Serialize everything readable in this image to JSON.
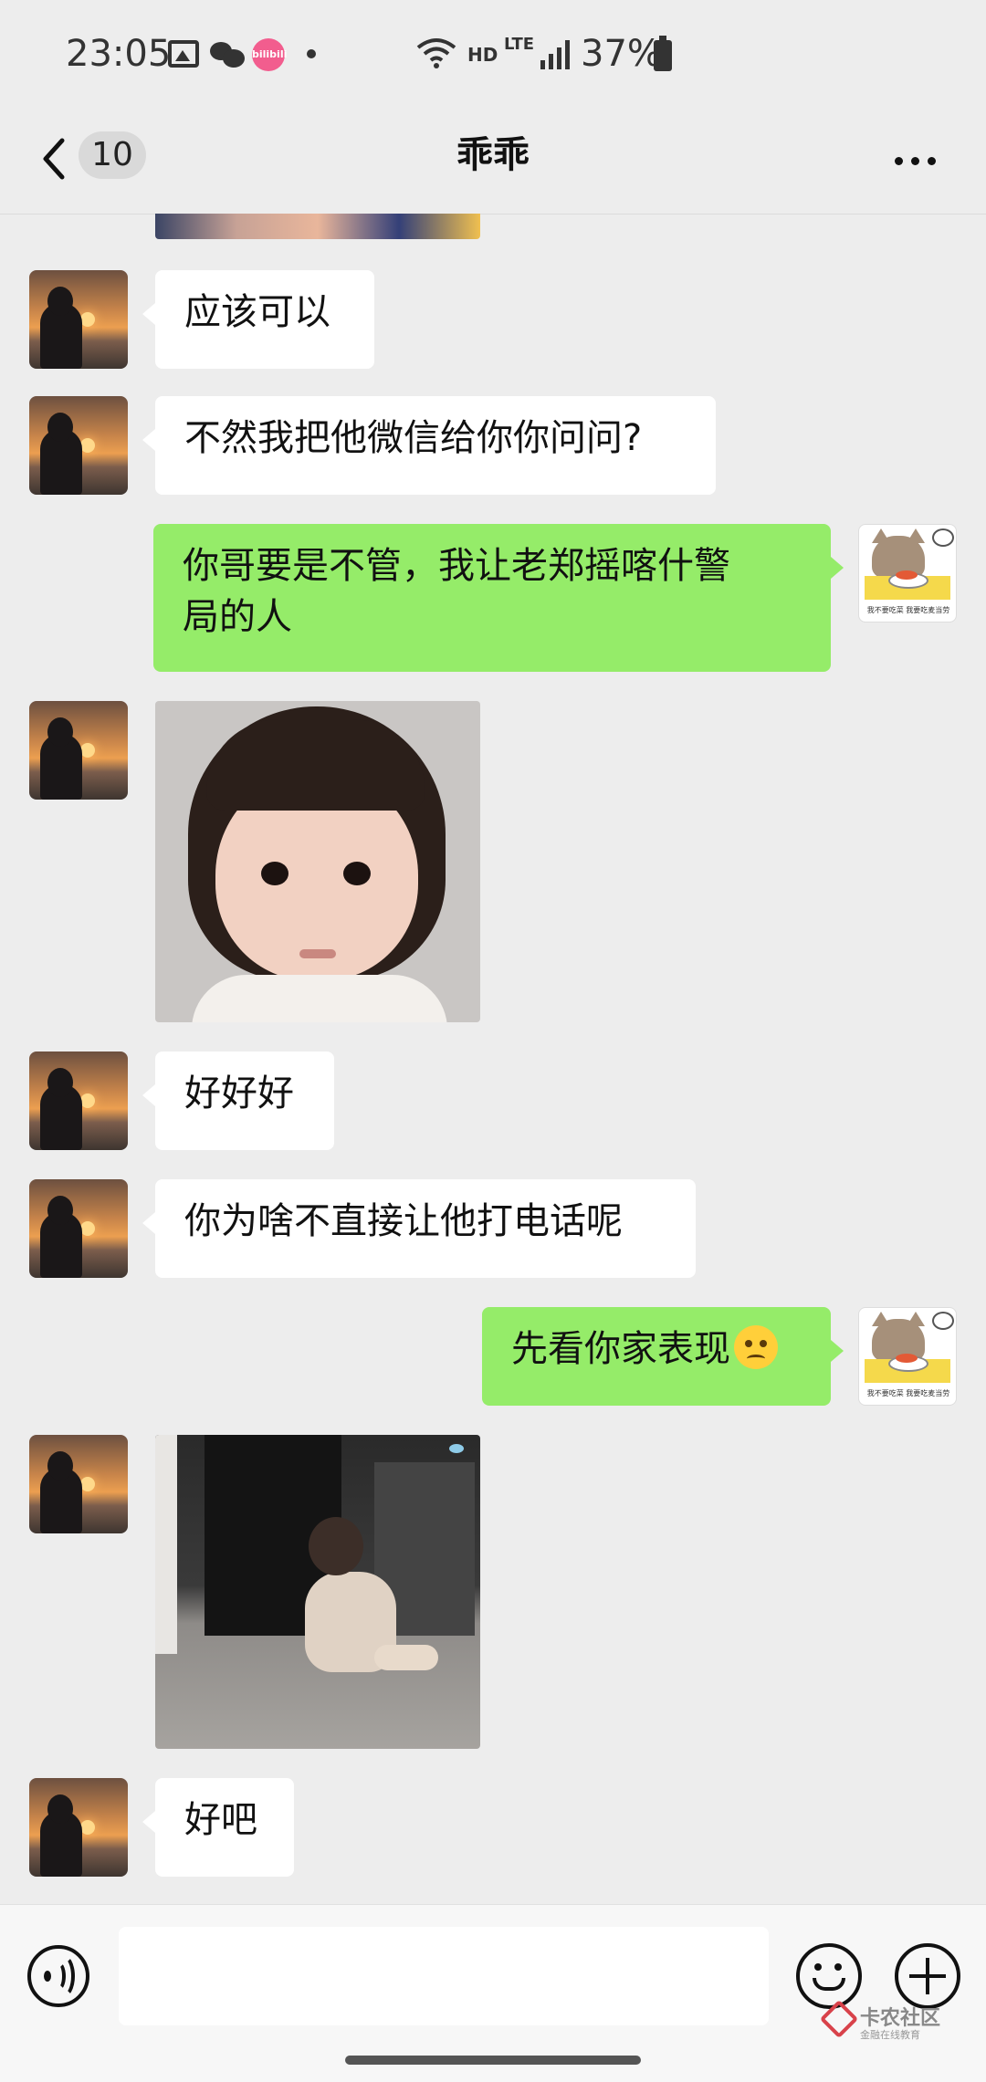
{
  "status_bar": {
    "time": "23:05",
    "icons": [
      "gallery-icon",
      "wechat-icon",
      "bilibili-icon",
      "dot-icon",
      "wifi-icon",
      "hd-icon",
      "lte-icon",
      "signal-icon",
      "battery-icon"
    ],
    "app_badge": "bilibili",
    "hd": "HD",
    "lte": "LTE",
    "battery": "37%"
  },
  "header": {
    "back_icon": "chevron-left-icon",
    "unread_count": "10",
    "title": "乖乖",
    "more_icon": "more-dots-icon"
  },
  "messages": [
    {
      "side": "left",
      "type": "image",
      "desc": "cropped-photo"
    },
    {
      "side": "left",
      "type": "text",
      "text": "应该可以"
    },
    {
      "side": "left",
      "type": "text",
      "text": "不然我把他微信给你你问问?"
    },
    {
      "side": "right",
      "type": "text",
      "line1": "你哥要是不管，我让老郑摇喀什警",
      "line2": "局的人"
    },
    {
      "side": "left",
      "type": "image",
      "desc": "girl-face-photo"
    },
    {
      "side": "left",
      "type": "text",
      "text": "好好好"
    },
    {
      "side": "left",
      "type": "text",
      "text": "你为啥不直接让他打电话呢"
    },
    {
      "side": "right",
      "type": "text",
      "text": "先看你家表现",
      "emoji": "confused-emoji-icon"
    },
    {
      "side": "left",
      "type": "image",
      "desc": "crawling-baby-photo"
    },
    {
      "side": "left",
      "type": "text",
      "text": "好吧"
    }
  ],
  "self_avatar_caption": "我不要吃菜 我要吃麦当劳",
  "input_bar": {
    "voice_icon": "voice-icon",
    "input_value": "",
    "emoji_icon": "emoji-icon",
    "plus_icon": "plus-icon"
  },
  "watermark": {
    "title": "卡农社区",
    "subtitle": "金融在线教育"
  },
  "colors": {
    "background": "#ededed",
    "self_bubble": "#95ec69",
    "other_bubble": "#ffffff",
    "badge_bilibili": "#f25d8e"
  }
}
